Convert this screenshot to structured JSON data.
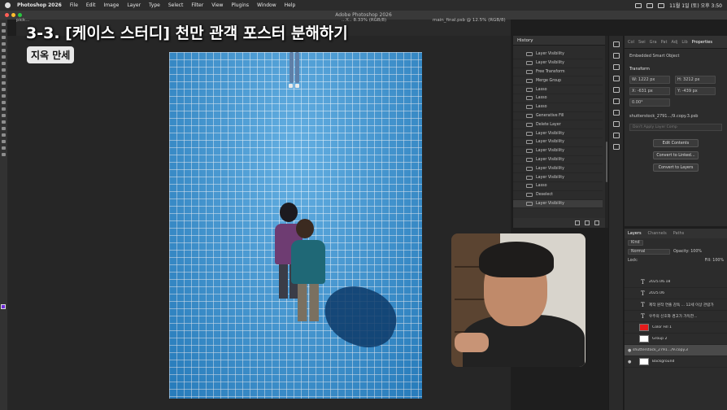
{
  "menubar": {
    "app_name": "Photoshop 2026",
    "items": [
      "File",
      "Edit",
      "Image",
      "Layer",
      "Type",
      "Select",
      "Filter",
      "View",
      "Plugins",
      "Window",
      "Help"
    ],
    "clock": "11월 1일 (토) 오후 3:50"
  },
  "window": {
    "title": "Adobe Photoshop 2026"
  },
  "tabs": [
    {
      "label": "pick..."
    },
    {
      "label": "...Y... 8.33% (RGB/8)"
    },
    {
      "label": "main_final.psb @ 12.5% (RGB/8)"
    }
  ],
  "overlay": {
    "title": "3-3. [케이스 스터디] 천만 관객 포스터 분해하기",
    "subtitle": "지옥 만세"
  },
  "history": {
    "panel_title": "History",
    "items": [
      "Layer Visibility",
      "Layer Visibility",
      "Free Transform",
      "Merge Group",
      "Lasso",
      "Lasso",
      "Lasso",
      "Generative Fill",
      "Delete Layer",
      "Layer Visibility",
      "Layer Visibility",
      "Layer Visibility",
      "Layer Visibility",
      "Layer Visibility",
      "Layer Visibility",
      "Lasso",
      "Deselect",
      "Layer Visibility"
    ]
  },
  "properties": {
    "tabs": [
      "Col",
      "Swi",
      "Gra",
      "Pat",
      "Adj",
      "Lib",
      "Properties"
    ],
    "layer_type": "Embedded Smart Object",
    "section": "Transform",
    "w": "W: 1222 px",
    "h": "H: 3212 px",
    "x": "X: -631 px",
    "y": "Y: -439 px",
    "angle": "0.00°",
    "file": "shutterstock_2791…/9.copy.3.psb",
    "comp_placeholder": "Don't Apply Layer Comp",
    "btn_edit": "Edit Contents",
    "btn_linked": "Convert to Linked…",
    "btn_layers": "Convert to Layers"
  },
  "layers": {
    "tabs": [
      "Layers",
      "Channels",
      "Paths"
    ],
    "filter": "Kind",
    "blend": "Normal",
    "opacity": "Opacity: 100%",
    "lock": "Lock:",
    "fill": "Fill: 100%",
    "items": [
      {
        "kind": "text",
        "name": "2025.06.18"
      },
      {
        "kind": "text",
        "name": "2025.06"
      },
      {
        "kind": "text",
        "name": "제작 원작 연출 감독 ... 12세 이상 관람가"
      },
      {
        "kind": "text",
        "name": "우주의 신호와 경고가 가득한..."
      },
      {
        "kind": "fill",
        "name": "Color Fill 1"
      },
      {
        "kind": "group",
        "name": "Group 2"
      },
      {
        "kind": "photo",
        "name": "shutterstock_2791…/9.copy.3"
      },
      {
        "kind": "bg",
        "name": "Background"
      }
    ]
  }
}
